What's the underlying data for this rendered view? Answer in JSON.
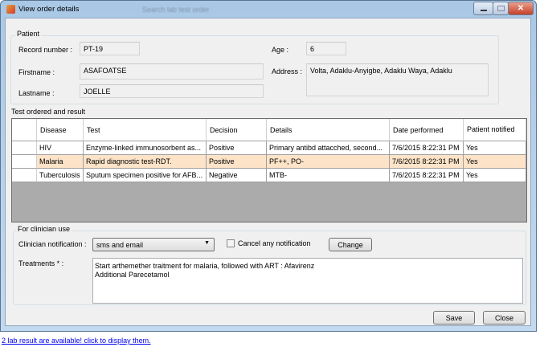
{
  "window": {
    "title": "View order details",
    "background_title": "Search lab test order"
  },
  "patient": {
    "group_label": "Patient",
    "record_label": "Record number :",
    "record_value": "PT-19",
    "age_label": "Age :",
    "age_value": "6",
    "firstname_label": "Firstname :",
    "firstname_value": "ASAFOATSE",
    "lastname_label": "Lastname :",
    "lastname_value": "JOELLE",
    "address_label": "Address :",
    "address_value": "Volta, Adaklu-Anyigbe, Adaklu Waya, Adaklu"
  },
  "tests": {
    "label": "Test ordered and result",
    "columns": [
      "Disease",
      "Test",
      "Decision",
      "Details",
      "Date performed",
      "Patient notified"
    ],
    "rows": [
      [
        "HIV",
        "Enzyme-linked immunosorbent as...",
        "Positive",
        "Primary antibd attacched, second...",
        "7/6/2015 8:22:31 PM",
        "Yes"
      ],
      [
        "Malaria",
        "Rapid diagnostic test-RDT.",
        "Positive",
        "PF++, PO-",
        "7/6/2015 8:22:31 PM",
        "Yes"
      ],
      [
        "Tuberculosis",
        "Sputum specimen positive for AFB...",
        "Negative",
        "MTB-",
        "7/6/2015 8:22:31 PM",
        "Yes"
      ]
    ],
    "selected_row": 1,
    "selected_color": "#fde3c8"
  },
  "clinician": {
    "group_label": "For clinician use",
    "notification_label": "Clinician notification :",
    "notification_value": "sms and email",
    "cancel_label": "Cancel any notification",
    "cancel_checked": false,
    "change_label": "Change",
    "treatments_label": "Treatments * :",
    "treatments_value": "Start arthemether traitment for malaria, followed with ART : Afavirenz\nAdditional Parecetamol"
  },
  "footer": {
    "save_label": "Save",
    "close_label": "Close",
    "lab_link": "2 lab result are available! click to display them."
  }
}
